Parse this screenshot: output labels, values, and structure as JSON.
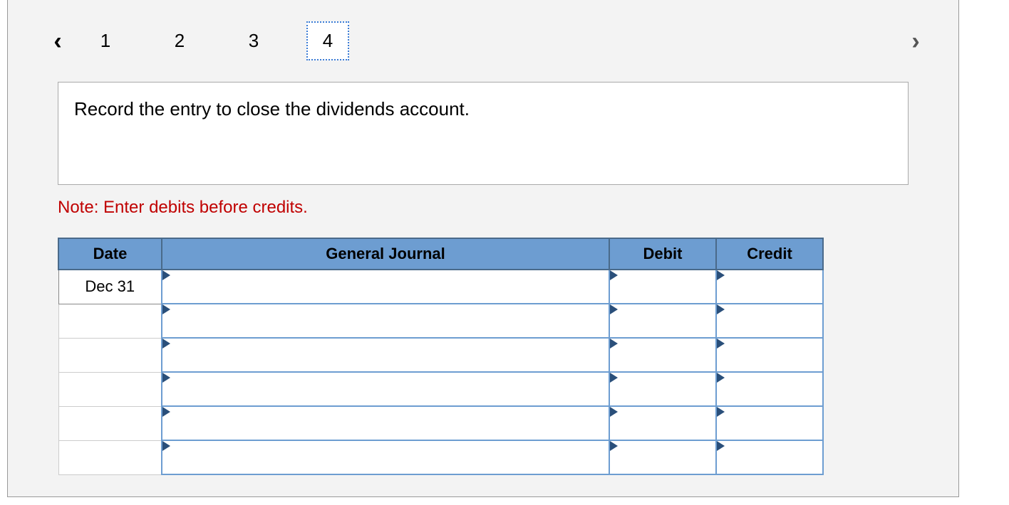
{
  "tabs": {
    "items": [
      "1",
      "2",
      "3",
      "4"
    ],
    "activeIndex": 3
  },
  "prompt": "Record the entry to close the dividends account.",
  "note": "Note: Enter debits before credits.",
  "journal": {
    "headers": {
      "date": "Date",
      "gj": "General Journal",
      "debit": "Debit",
      "credit": "Credit"
    },
    "rows": [
      {
        "date": "Dec 31",
        "gj": "",
        "debit": "",
        "credit": ""
      },
      {
        "date": "",
        "gj": "",
        "debit": "",
        "credit": ""
      },
      {
        "date": "",
        "gj": "",
        "debit": "",
        "credit": ""
      },
      {
        "date": "",
        "gj": "",
        "debit": "",
        "credit": ""
      },
      {
        "date": "",
        "gj": "",
        "debit": "",
        "credit": ""
      },
      {
        "date": "",
        "gj": "",
        "debit": "",
        "credit": ""
      }
    ]
  }
}
